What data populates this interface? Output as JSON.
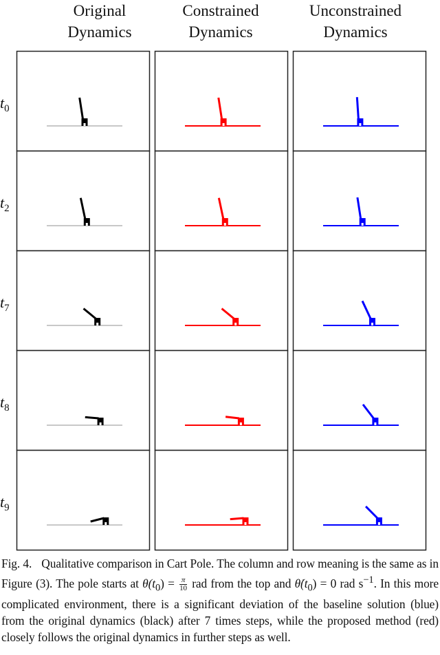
{
  "columns": [
    {
      "line1": "Original",
      "line2": "Dynamics",
      "color": "#000000",
      "track_color": "#c8c8c8"
    },
    {
      "line1": "Constrained",
      "line2": "Dynamics",
      "color": "#ff0000",
      "track_color": "#ff0000"
    },
    {
      "line1": "Unconstrained",
      "line2": "Dynamics",
      "color": "#0000ff",
      "track_color": "#0000ff"
    }
  ],
  "rows": [
    {
      "label": "t",
      "subscript": "0"
    },
    {
      "label": "t",
      "subscript": "2"
    },
    {
      "label": "t",
      "subscript": "7"
    },
    {
      "label": "t",
      "subscript": "8"
    },
    {
      "label": "t",
      "subscript": "9"
    }
  ],
  "states": {
    "note": "cart_pos = cart center as fraction of track length (0 left, 1 right); pole_angle_deg = pole angle from upright, positive = leaning left",
    "original": [
      {
        "cart_pos": 0.5,
        "pole_angle_deg": 14
      },
      {
        "cart_pos": 0.53,
        "pole_angle_deg": 19
      },
      {
        "cart_pos": 0.67,
        "pole_angle_deg": 63
      },
      {
        "cart_pos": 0.71,
        "pole_angle_deg": 87
      },
      {
        "cart_pos": 0.78,
        "pole_angle_deg": 99
      }
    ],
    "constrained": [
      {
        "cart_pos": 0.51,
        "pole_angle_deg": 14
      },
      {
        "cart_pos": 0.53,
        "pole_angle_deg": 19
      },
      {
        "cart_pos": 0.67,
        "pole_angle_deg": 63
      },
      {
        "cart_pos": 0.74,
        "pole_angle_deg": 86
      },
      {
        "cart_pos": 0.8,
        "pole_angle_deg": 93
      }
    ],
    "unconstrained": [
      {
        "cart_pos": 0.49,
        "pole_angle_deg": 6
      },
      {
        "cart_pos": 0.52,
        "pole_angle_deg": 14
      },
      {
        "cart_pos": 0.65,
        "pole_angle_deg": 37
      },
      {
        "cart_pos": 0.69,
        "pole_angle_deg": 51
      },
      {
        "cart_pos": 0.74,
        "pole_angle_deg": 58
      }
    ]
  },
  "caption": {
    "fig_label": "Fig. 4.",
    "part1": "Qualitative comparison in Cart Pole. The column and row meaning is the same as in Figure (3). The pole starts at ",
    "theta_expr": "θ(t",
    "theta_sub": "0",
    "theta_close": ") = ",
    "frac_num": "π",
    "frac_den": "10",
    "part2": " rad from the top and ",
    "thetadot_expr": "θ̇(t",
    "thetadot_sub": "0",
    "thetadot_close": ") = 0 rad s",
    "thetadot_exp": "−1",
    "part3": ". In this more complicated environment, there is a significant deviation of the baseline solution (blue) from the original dynamics (black) after 7 times steps, while the proposed method (red) closely follows the original dynamics in further steps as well."
  }
}
